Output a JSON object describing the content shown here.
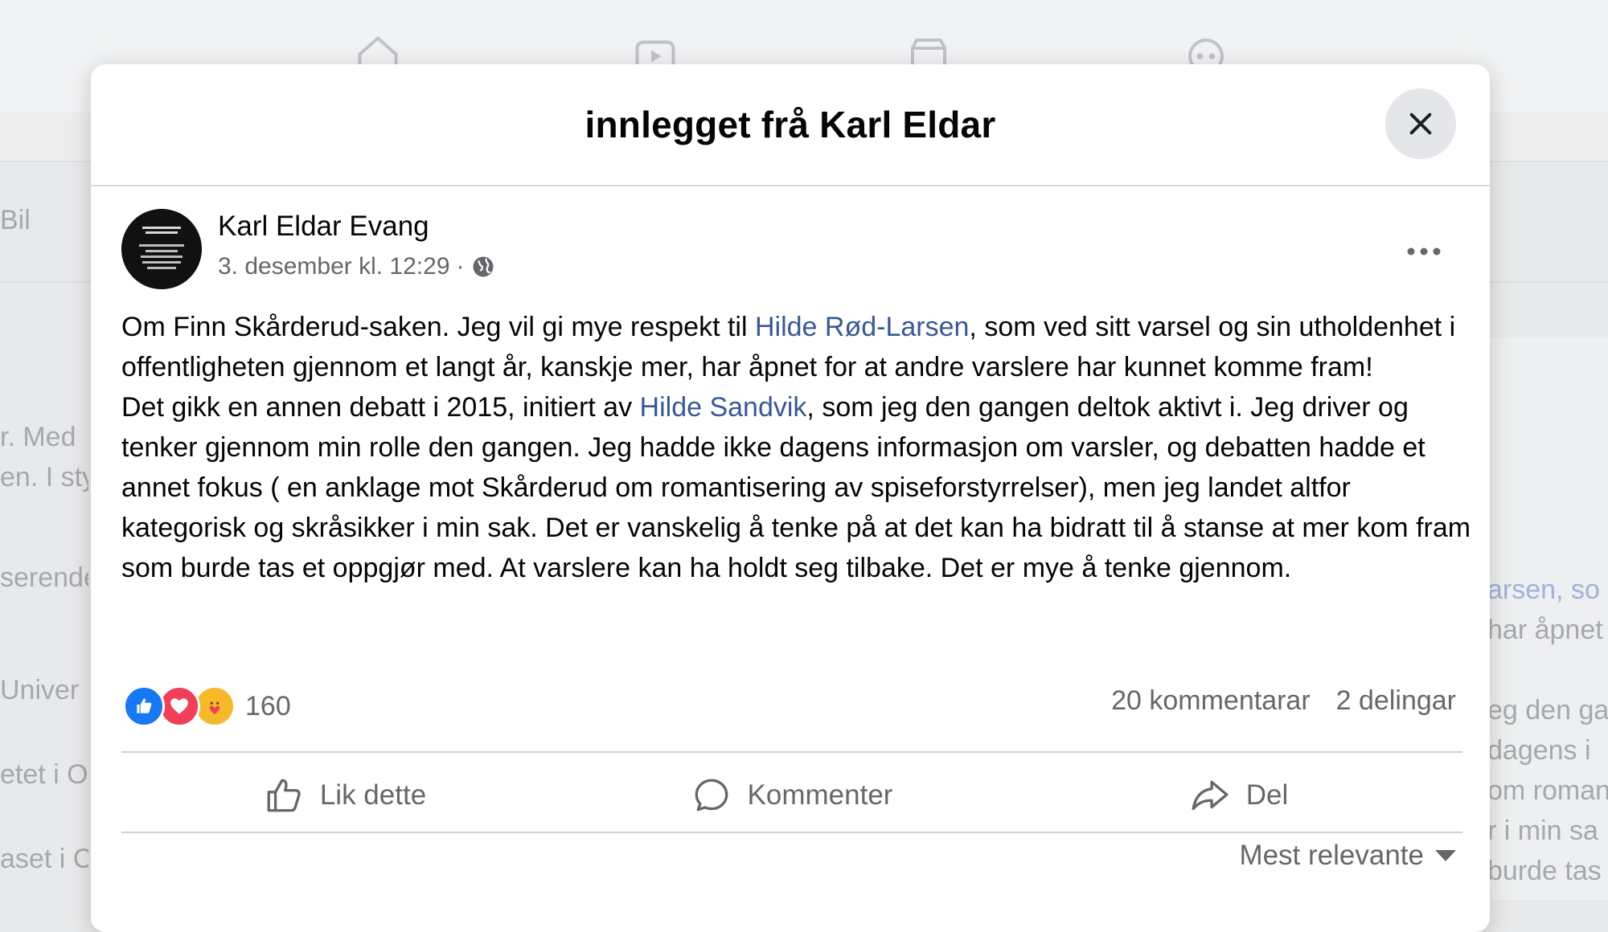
{
  "background": {
    "left_fragments": [
      "Bil",
      "r. Med",
      "en. I sty",
      "serende",
      "Univer",
      "etet i O",
      "aset i C"
    ],
    "right_fragments": [
      "arsen, so",
      "har åpnet",
      "eg den ga",
      "dagens i",
      "om roman",
      "r i min sa",
      "burde tas"
    ]
  },
  "modal": {
    "title": "innlegget frå Karl Eldar"
  },
  "post": {
    "author": "Karl Eldar Evang",
    "timestamp": "3. desember kl. 12:29",
    "meta_separator": "·",
    "paragraph1": {
      "before": "Om Finn Skårderud-saken. Jeg vil gi mye respekt til ",
      "mention": "Hilde Rød-Larsen",
      "after": ", som ved sitt varsel og sin utholdenhet i offentligheten gjennom et langt år, kanskje mer, har åpnet for at andre varslere har kunnet komme fram!"
    },
    "paragraph2": {
      "before": "Det gikk en annen debatt i 2015, initiert av ",
      "mention": "Hilde Sandvik",
      "after": ", som jeg den gangen deltok aktivt i. Jeg driver og tenker gjennom min rolle den gangen. Jeg hadde ikke dagens informasjon om varsler, og debatten hadde et annet fokus ( en anklage mot Skårderud om romantisering av spiseforstyrrelser), men jeg landet altfor kategorisk og skråsikker i min sak. Det er vanskelig å tenke på at det kan ha bidratt til å stanse at mer kom fram som burde tas et oppgjør med. At varslere kan ha holdt seg tilbake. Det er mye å tenke gjennom."
    },
    "reaction_count": "160",
    "comments": "20 kommentarar",
    "shares": "2 delingar"
  },
  "actions": {
    "like": "Lik dette",
    "comment": "Kommenter",
    "share": "Del"
  },
  "sort": {
    "selected": "Mest relevante"
  },
  "colors": {
    "mention": "#385898",
    "secondary_text": "#65676b",
    "like_blue": "#1877f2",
    "love_red": "#f33e58",
    "care_yellow": "#f7b928"
  }
}
